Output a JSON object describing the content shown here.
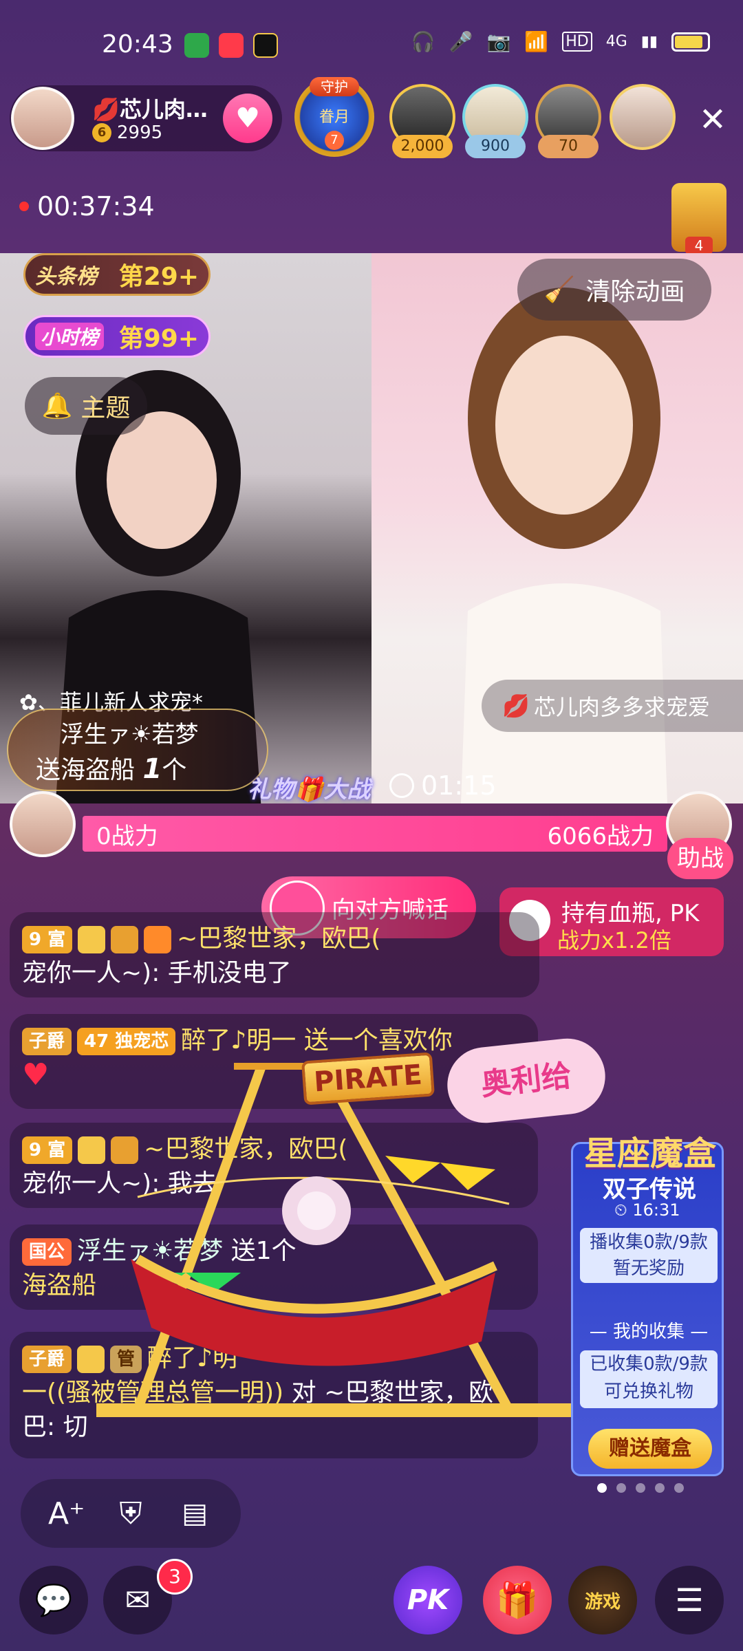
{
  "status_bar": {
    "time": "20:43",
    "icons": [
      "headphone-icon",
      "mic-icon",
      "camera-icon",
      "wifi-icon",
      "hd-icon",
      "signal-4g-icon",
      "signal-x-icon",
      "battery-icon"
    ],
    "hd": "HD",
    "net": "4G"
  },
  "header": {
    "anchor_name": "芯儿肉…",
    "anchor_level": "6",
    "anchor_fans": "2995",
    "guard_tag": "守护",
    "guard_text": "眷月",
    "guard_num": "7",
    "viewers": [
      {
        "count": "2,000"
      },
      {
        "count": "900"
      },
      {
        "count": "70"
      },
      {
        "count": ""
      }
    ],
    "live_time": "00:37:34",
    "guard_chest_count": "4"
  },
  "video": {
    "rank_headline_tag": "头条榜",
    "rank_headline_value": "第29+",
    "rank_hourly_tag": "小时榜",
    "rank_hourly_value": "第99+",
    "theme_label": "主题",
    "clear_anim_label": "清除动画",
    "partner_name": "芯儿肉多多求宠爱",
    "left_label": "、菲儿新人求宠*",
    "gift_user": "浮生ァ☀若梦",
    "gift_text_prefix": "送海盗船",
    "gift_qty": "1",
    "gift_unit": "个"
  },
  "pk": {
    "title": "礼物🎁大战",
    "timer": "01:15",
    "left_power": "0战力",
    "right_power": "6066战力",
    "assist_label": "助战",
    "shout_label": "向对方喊话",
    "potion_line1": "持有血瓶, PK",
    "potion_line2": "战力x1.2倍"
  },
  "chat": [
    {
      "badge": "9 富",
      "user": "~巴黎世家，欧巴(",
      "user2": "宠你一人~):",
      "msg": "手机没电了"
    },
    {
      "badge": "子爵",
      "badge2": "独宠芯",
      "badge2_level": "47",
      "user": "醉了♪明一",
      "msg": "送一个喜欢你"
    },
    {
      "badge": "9 富",
      "user": "~巴黎世家，欧巴(",
      "user2": "宠你一人~):",
      "msg": "我去"
    },
    {
      "badge": "国公",
      "user": "浮生ァ☀若梦",
      "msg": "送1个",
      "gift": "海盗船"
    },
    {
      "badge": "子爵",
      "badge_admin": "管",
      "user": "醉了♪明",
      "user2": "一((骚被管理总管一明))",
      "msg": "对 ~巴黎世家，欧巴: 切"
    }
  ],
  "overlay": {
    "pirate_sign": "PIRATE",
    "olige": "奥利给"
  },
  "magic_box": {
    "title": "星座魔盒",
    "subtitle": "双子传说",
    "time": "16:31",
    "broadcast_line": "播收集0款/9款",
    "no_reward": "暂无奖励",
    "my_collect": "我的收集",
    "collected_line": "已收集0款/9款",
    "redeem": "可兑换礼物",
    "gift_btn": "赠送魔盒"
  },
  "bottom": {
    "msg_badge": "3",
    "pk_label": "PK",
    "game_label": "游戏"
  }
}
